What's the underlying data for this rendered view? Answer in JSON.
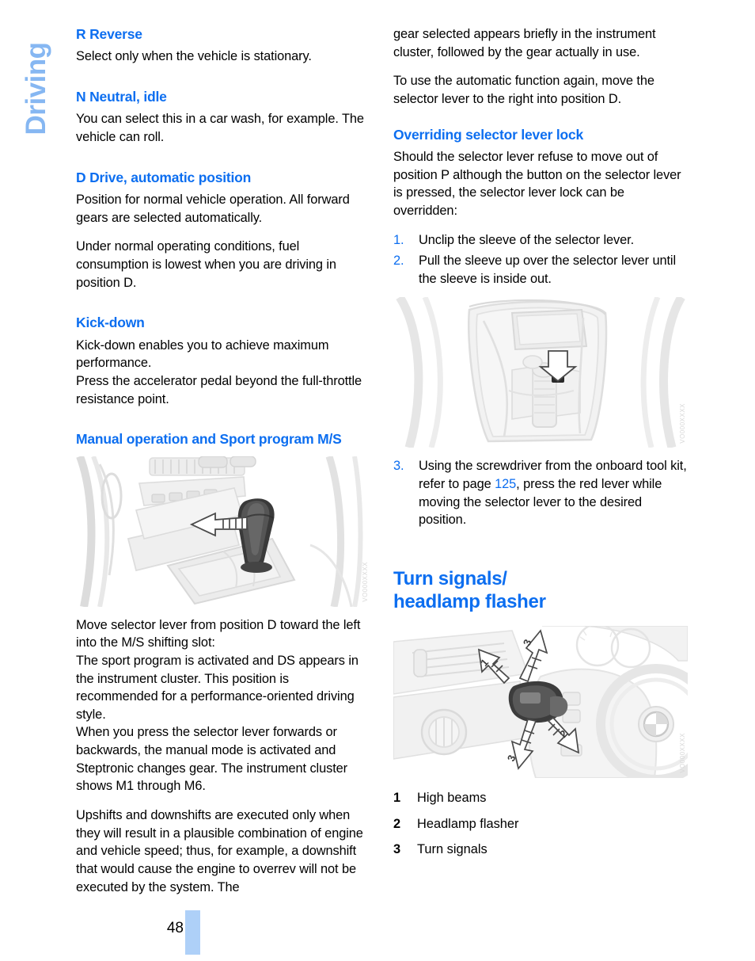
{
  "chapter": {
    "tab_label": "Driving"
  },
  "left_column": {
    "sections": [
      {
        "heading": "R Reverse",
        "paragraphs": [
          "Select only when the vehicle is stationary."
        ]
      },
      {
        "heading": "N Neutral, idle",
        "paragraphs": [
          "You can select this in a car wash, for example. The vehicle can roll."
        ]
      },
      {
        "heading": "D Drive, automatic position",
        "paragraphs": [
          "Position for normal vehicle operation. All forward gears are selected automatically.",
          "Under normal operating conditions, fuel consumption is lowest when you are driving in position D."
        ]
      },
      {
        "heading": "Kick-down",
        "paragraphs": [
          "Kick-down enables you to achieve maximum performance.\nPress the accelerator pedal beyond the full-throttle resistance point."
        ]
      },
      {
        "heading": "Manual operation and Sport program M/S",
        "paragraphs": []
      }
    ],
    "figure_selector_lever": {
      "name": "selector-lever-ms-slot",
      "code": "VO000XXXX"
    },
    "after_figure_paragraphs": [
      "Move selector lever from position D toward the left into the M/S shifting slot:\nThe sport program is activated and DS appears in the instrument cluster. This position is recommended for a performance-oriented driving style.\nWhen you press the selector lever forwards or backwards, the manual mode is activated and Steptronic changes gear. The instrument cluster shows M1 through M6.",
      "Upshifts and downshifts are executed only when they will result in a plausible combination of engine and vehicle speed; thus, for example, a downshift that would cause the engine to overrev will not be executed by the system. The"
    ]
  },
  "right_column": {
    "continued_paragraphs": [
      "gear selected appears briefly in the instrument cluster, followed by the gear actually in use.",
      "To use the automatic function again, move the selector lever to the right into position D."
    ],
    "override_section": {
      "heading": "Overriding selector lever lock",
      "intro": "Should the selector lever refuse to move out of position P although the button on the selector lever is pressed, the selector lever lock can be overridden:",
      "steps_before_figure": [
        {
          "num": "1.",
          "text": "Unclip the sleeve of the selector lever."
        },
        {
          "num": "2.",
          "text": "Pull the sleeve up over the selector lever until the sleeve is inside out."
        }
      ],
      "figure": {
        "name": "selector-lever-sleeve-removed",
        "code": "VO000XXXX"
      },
      "steps_after_figure": [
        {
          "num": "3.",
          "text_before_link": "Using the screwdriver from the onboard tool kit, refer to page ",
          "link": "125",
          "text_after_link": ", press the red lever while moving the selector lever to the desired position."
        }
      ]
    },
    "turn_signals_section": {
      "heading_line1": "Turn signals/",
      "heading_line2": "headlamp flasher",
      "figure": {
        "name": "turn-signal-stalk",
        "code": "VO000XXXX"
      },
      "legend": [
        {
          "key": "1",
          "label": "High beams"
        },
        {
          "key": "2",
          "label": "Headlamp flasher"
        },
        {
          "key": "3",
          "label": "Turn signals"
        }
      ]
    }
  },
  "footer": {
    "page_number": "48"
  },
  "colors": {
    "heading_blue": "#0c6ef0",
    "tab_blue": "#86b7f2",
    "footer_bar_blue": "#aed0f8",
    "body_black": "#000000"
  }
}
